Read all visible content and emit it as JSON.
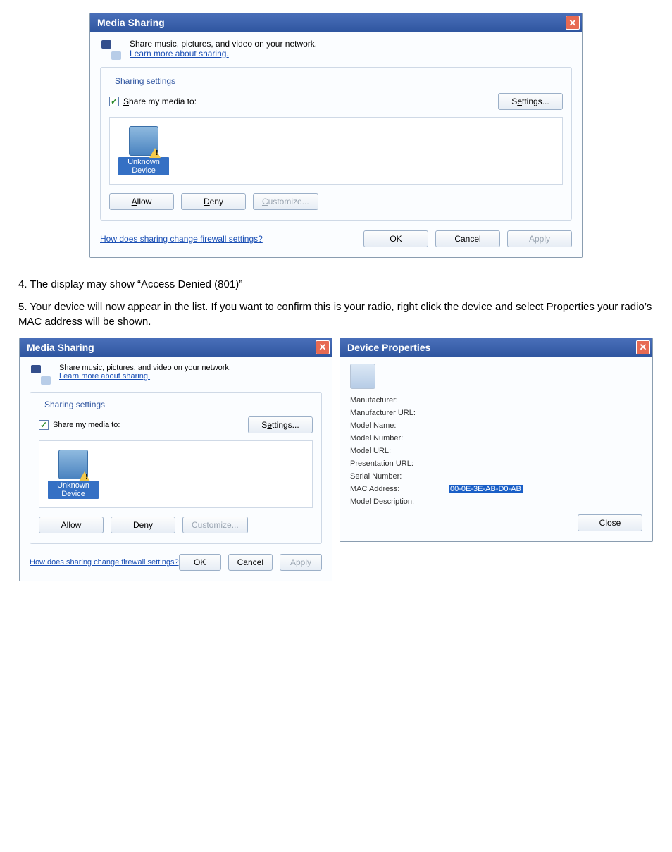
{
  "dlg1": {
    "title": "Media Sharing",
    "intro": "Share music, pictures, and video on your network.",
    "learn": "Learn more about sharing.",
    "group": "Sharing settings",
    "share_label": "Share my media to:",
    "settings_btn": "Settings...",
    "device_label": "Unknown Device",
    "allow": "Allow",
    "deny": "Deny",
    "customize": "Customize...",
    "firewall": "How does sharing change firewall settings?",
    "ok": "OK",
    "cancel": "Cancel",
    "apply": "Apply"
  },
  "doc": {
    "step4": "4. The display may show “Access Denied (801)”",
    "step5": "5. Your device will now appear in the list.  If you want to confirm this is your radio, right click the device and select Properties your radio’s MAC address will be shown."
  },
  "dlg2": {
    "title": "Media Sharing",
    "intro": "Share music, pictures, and video on your network.",
    "learn": "Learn more about sharing.",
    "group": "Sharing settings",
    "share_label": "Share my media to:",
    "settings_btn": "Settings...",
    "device_label": "Unknown Device",
    "allow": "Allow",
    "deny": "Deny",
    "customize": "Customize...",
    "firewall": "How does sharing change firewall settings?",
    "ok": "OK",
    "cancel": "Cancel",
    "apply": "Apply"
  },
  "dlg3": {
    "title": "Device Properties",
    "labels": {
      "manufacturer": "Manufacturer:",
      "manufacturer_url": "Manufacturer URL:",
      "model_name": "Model Name:",
      "model_number": "Model Number:",
      "model_url": "Model URL:",
      "presentation_url": "Presentation URL:",
      "serial_number": "Serial Number:",
      "mac_address": "MAC Address:",
      "model_description": "Model Description:"
    },
    "mac_value": "00-0E-3E-AB-D0-AB",
    "close": "Close"
  }
}
